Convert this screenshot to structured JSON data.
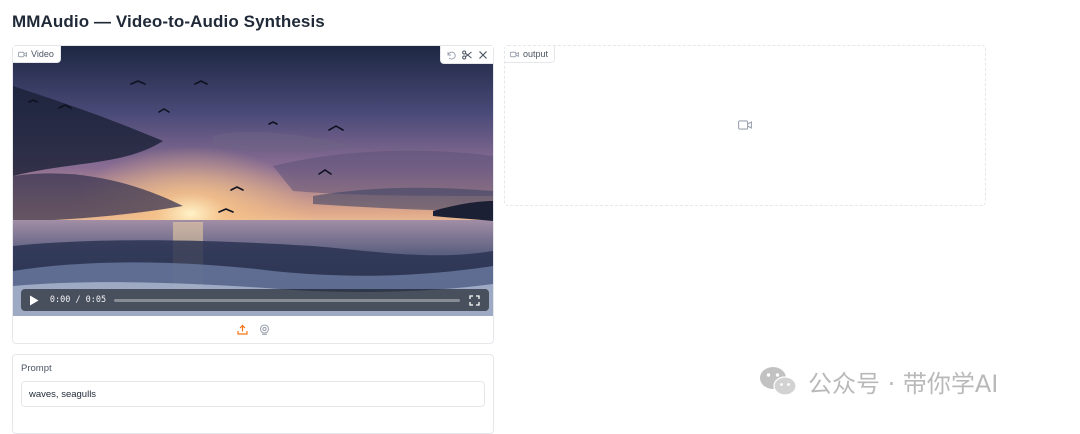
{
  "page": {
    "title": "MMAudio — Video-to-Audio Synthesis"
  },
  "video_input": {
    "label": "Video",
    "icons": [
      "video-camera-icon",
      "undo-icon",
      "scissors-icon",
      "close-icon"
    ],
    "player": {
      "current_time": "0:00",
      "duration": "0:05",
      "time_display": "0:00 / 0:05",
      "progress": 0.0
    },
    "source_icons": [
      "upload-icon",
      "webcam-icon"
    ]
  },
  "video_output": {
    "label": "output",
    "icons": [
      "video-camera-icon"
    ]
  },
  "prompt": {
    "label": "Prompt",
    "value": "waves, seagulls"
  },
  "watermark": {
    "text": "公众号 · 带你学AI",
    "icon": "wechat-logo-icon"
  },
  "colors": {
    "accent": "#f97316",
    "border": "#e5e7eb",
    "text": "#1f2937",
    "muted": "#4b5563"
  }
}
